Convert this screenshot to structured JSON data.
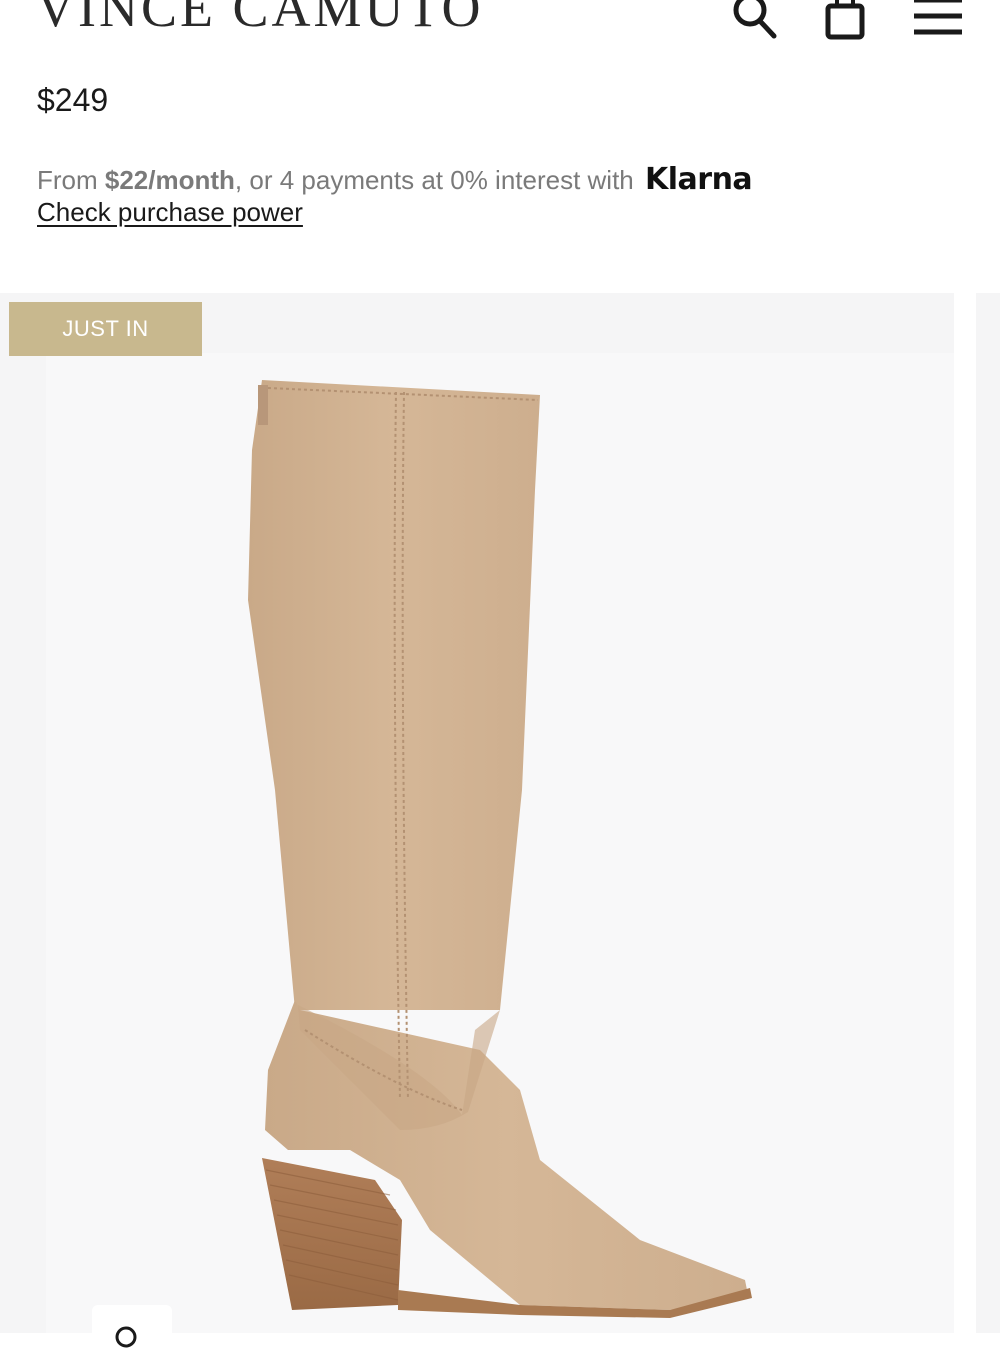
{
  "header": {
    "brand": "VINCE CAMUTO",
    "icons": [
      "search-icon",
      "shopping-bag-icon",
      "menu-icon"
    ]
  },
  "product": {
    "price": "$249"
  },
  "financing": {
    "prefix": "From ",
    "monthly": "$22/month",
    "middle": ", or 4 payments at 0% interest with ",
    "provider": "Klarna",
    "link": "Check purchase power"
  },
  "gallery": {
    "badge": "JUST IN",
    "badge_color": "#c8b88e",
    "background": "#f5f5f6"
  },
  "colors": {
    "boot_suede": "#d2b393",
    "boot_heel": "#a87651"
  }
}
